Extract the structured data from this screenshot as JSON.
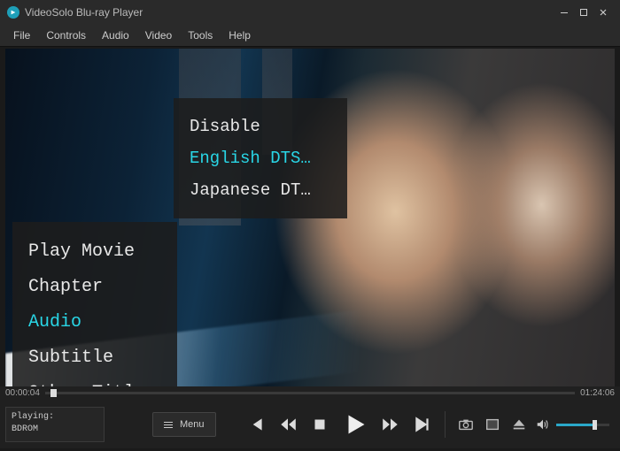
{
  "titlebar": {
    "app_name": "VideoSolo Blu-ray Player"
  },
  "menubar": {
    "items": [
      "File",
      "Controls",
      "Audio",
      "Video",
      "Tools",
      "Help"
    ]
  },
  "main_menu": {
    "items": [
      "Play Movie",
      "Chapter",
      "Audio",
      "Subtitle",
      "Other Titles"
    ],
    "selected_index": 2
  },
  "audio_menu": {
    "items": [
      "Disable",
      "English DTS…",
      "Japanese DT…"
    ],
    "selected_index": 1
  },
  "time": {
    "elapsed": "00:00:04",
    "total": "01:24:06"
  },
  "status": {
    "label": "Playing:",
    "source": "BDROM"
  },
  "menu_button": {
    "label": "Menu"
  }
}
